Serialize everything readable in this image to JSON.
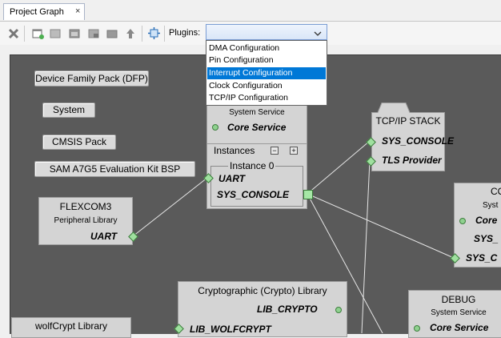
{
  "tab": {
    "title": "Project Graph",
    "close": "×"
  },
  "toolbar": {
    "plugins_label": "Plugins:",
    "plugins_value": ""
  },
  "plugins_menu": {
    "options": [
      "DMA Configuration",
      "Pin Configuration",
      "Interrupt Configuration",
      "Clock Configuration",
      "TCP/IP Configuration"
    ],
    "selected": "Interrupt Configuration"
  },
  "graph": {
    "chips": [
      "Device Family Pack (DFP)",
      "System",
      "CMSIS Pack",
      "SAM A7G5 Evaluation Kit BSP"
    ],
    "core": {
      "subtitle": "System Service",
      "name": "Core Service",
      "instances_label": "Instances",
      "minus": "−",
      "plus": "+",
      "instance_label": "Instance 0",
      "uart": "UART",
      "console": "SYS_CONSOLE"
    },
    "tcpip": {
      "title": "TCP/IP STACK",
      "console": "SYS_CONSOLE",
      "tls": "TLS Provider"
    },
    "flexcom": {
      "title": "FLEXCOM3",
      "subtitle": "Peripheral Library",
      "uart": "UART"
    },
    "right_partial": {
      "title": "CO",
      "subtitle": "Syst",
      "name": "Core",
      "sys": "SYS_",
      "console": "SYS_C"
    },
    "crypto": {
      "title": "Cryptographic (Crypto) Library",
      "lib": "LIB_CRYPTO",
      "wolf": "LIB_WOLFCRYPT"
    },
    "debug": {
      "title": "DEBUG",
      "subtitle": "System Service",
      "name": "Core Service"
    },
    "wolf": {
      "title": "wolfCrypt Library"
    }
  }
}
